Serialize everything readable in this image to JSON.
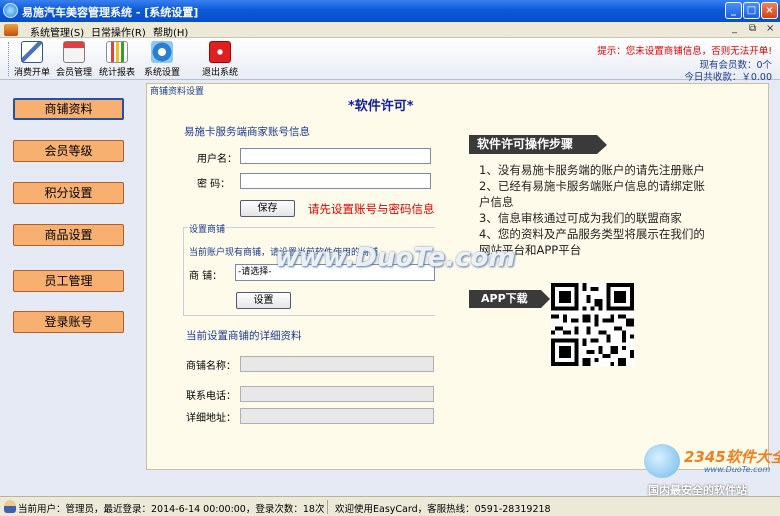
{
  "window": {
    "title": "易施汽车美容管理系统 - [系统设置]",
    "min": "_",
    "max": "□",
    "close": "×"
  },
  "menu": {
    "items": [
      "系统管理(S)",
      "日常操作(R)",
      "帮助(H)"
    ],
    "min": "_",
    "restore": "⧉",
    "close": "×"
  },
  "toolbar": {
    "items": [
      "消费开单",
      "会员管理",
      "统计报表",
      "系统设置",
      "退出系统"
    ]
  },
  "top_right": {
    "warning": "提示：您未设置商铺信息，否则无法开单!",
    "member_count": "现有会员数：0个",
    "today_income": "今日共收款：￥0.00"
  },
  "sidebar": {
    "items": [
      "商铺资料",
      "会员等级",
      "积分设置",
      "商品设置",
      "员工管理",
      "登录账号"
    ]
  },
  "panel": {
    "legend": "商铺资料设置",
    "title": "*软件许可*",
    "account_section": "易施卡服务端商家账号信息",
    "username_label": "用户名：",
    "password_label": "密   码：",
    "save_button": "保存",
    "account_hint": "请先设置账号与密码信息",
    "shop_group_legend": "设置商铺",
    "shop_group_note": "当前账户现有商铺，请设置当前软件使用的商铺",
    "shop_label": "商   铺：",
    "shop_select_value": "-请选择-",
    "set_button": "设置",
    "detail_section": "当前设置商铺的详细资料",
    "shop_name_label": "商铺名称：",
    "phone_label": "联系电话：",
    "address_label": "详细地址："
  },
  "steps": {
    "banner": "软件许可操作步骤",
    "lines": [
      "1、没有易施卡服务端的账户的请先注册账户",
      "2、已经有易施卡服务端账户信息的请绑定账",
      "    户信息",
      "3、信息审核通过可成为我们的联盟商家",
      "4、您的资料及产品服务类型将展示在我们的",
      "    网站平台和APP平台"
    ]
  },
  "app_download": "APP下载",
  "watermark": "www.DuoTe.com",
  "status": {
    "user_info": "当前用户：管理员，最近登录：2014-6-14 00:00:00，登录次数：18次",
    "welcome": "欢迎使用EasyCard，客服热线：0591-28319218"
  },
  "corner_logo": {
    "brand": "2345软件大全",
    "url": "www.DuoTe.com",
    "slogan": "国内最安全的软件站"
  }
}
